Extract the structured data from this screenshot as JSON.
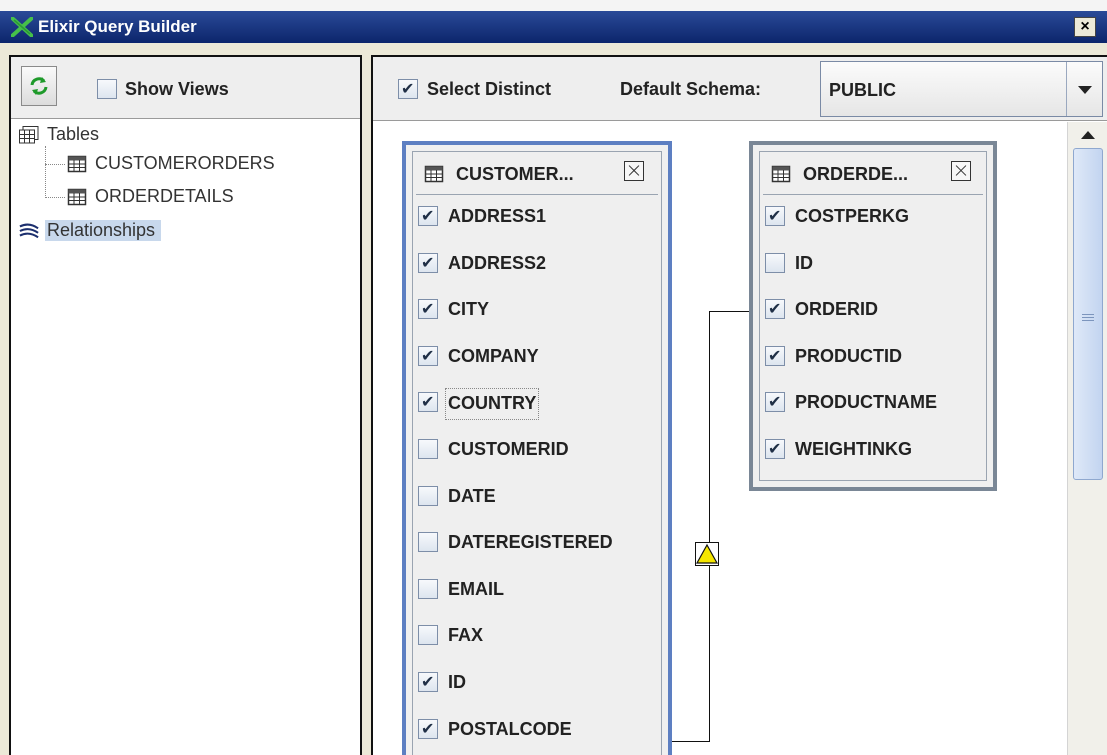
{
  "window": {
    "title": "Elixir Query Builder",
    "close_glyph": "×"
  },
  "left_panel": {
    "show_views": {
      "label": "Show Views",
      "checked": false
    },
    "tree": {
      "root_label": "Tables",
      "children": [
        "CUSTOMERORDERS",
        "ORDERDETAILS"
      ],
      "relationships_label": "Relationships"
    }
  },
  "toolbar": {
    "select_distinct": {
      "label": "Select Distinct",
      "checked": true
    },
    "schema_label": "Default Schema:",
    "schema_value": "PUBLIC"
  },
  "tables": [
    {
      "title": "CUSTOMER...",
      "fields": [
        {
          "name": "ADDRESS1",
          "checked": true
        },
        {
          "name": "ADDRESS2",
          "checked": true
        },
        {
          "name": "CITY",
          "checked": true
        },
        {
          "name": "COMPANY",
          "checked": true
        },
        {
          "name": "COUNTRY",
          "checked": true,
          "focused": true
        },
        {
          "name": "CUSTOMERID",
          "checked": false
        },
        {
          "name": "DATE",
          "checked": false
        },
        {
          "name": "DATEREGISTERED",
          "checked": false
        },
        {
          "name": "EMAIL",
          "checked": false
        },
        {
          "name": "FAX",
          "checked": false
        },
        {
          "name": "ID",
          "checked": true
        },
        {
          "name": "POSTALCODE",
          "checked": true
        }
      ]
    },
    {
      "title": "ORDERDE...",
      "fields": [
        {
          "name": "COSTPERKG",
          "checked": true
        },
        {
          "name": "ID",
          "checked": false
        },
        {
          "name": "ORDERID",
          "checked": true
        },
        {
          "name": "PRODUCTID",
          "checked": true
        },
        {
          "name": "PRODUCTNAME",
          "checked": true
        },
        {
          "name": "WEIGHTINKG",
          "checked": true
        }
      ]
    }
  ],
  "colors": {
    "title_bar": "#0c256b",
    "customer_border": "#5d7fc2",
    "orderdetails_border": "#7a8796",
    "relationship_marker": "#f5e600"
  }
}
